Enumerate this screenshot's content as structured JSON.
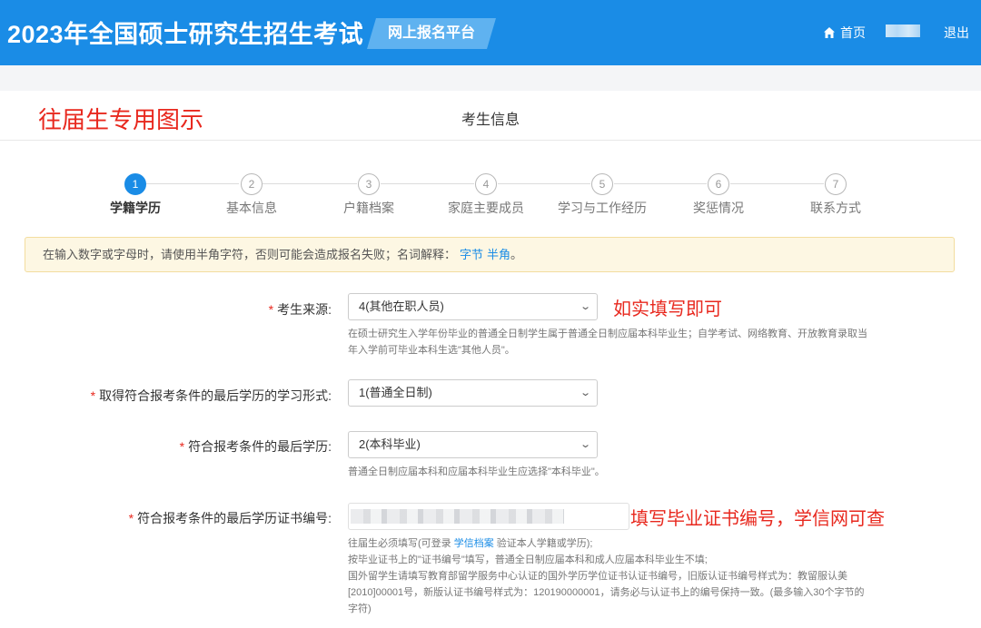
{
  "header": {
    "site_title": "2023年全国硕士研究生招生考试",
    "platform_label": "网上报名平台",
    "home_label": "首页",
    "logout_label": "退出",
    "home_icon": "home-icon"
  },
  "watermark": "往届生专用图示",
  "card_title": "考生信息",
  "steps": [
    {
      "num": "1",
      "label": "学籍学历",
      "active": true
    },
    {
      "num": "2",
      "label": "基本信息",
      "active": false
    },
    {
      "num": "3",
      "label": "户籍档案",
      "active": false
    },
    {
      "num": "4",
      "label": "家庭主要成员",
      "active": false
    },
    {
      "num": "5",
      "label": "学习与工作经历",
      "active": false
    },
    {
      "num": "6",
      "label": "奖惩情况",
      "active": false
    },
    {
      "num": "7",
      "label": "联系方式",
      "active": false
    }
  ],
  "notice": {
    "text": "在输入数字或字母时，请使用半角字符，否则可能会造成报名失败；名词解释：",
    "link1": "字节",
    "link2": "半角",
    "end": "。"
  },
  "form": {
    "source": {
      "label": "考生来源:",
      "value": "4(其他在职人员)",
      "help_line1": "在硕士研究生入学年份毕业的普通全日制学生属于普通全日制应届本科毕业生；自学考试、网络教育、开放教育录取当",
      "help_line2": "年入学前可毕业本科生选\"其他人员\"。",
      "annotation": "如实填写即可"
    },
    "study_form": {
      "label": "取得符合报考条件的最后学历的学习形式:",
      "value": "1(普通全日制)"
    },
    "last_degree": {
      "label": "符合报考条件的最后学历:",
      "value": "2(本科毕业)",
      "help": "普通全日制应届本科和应届本科毕业生应选择\"本科毕业\"。"
    },
    "cert_no": {
      "label": "符合报考条件的最后学历证书编号:",
      "annotation": "填写毕业证书编号，学信网可查",
      "help_a": "往届生必须填写(可登录 ",
      "help_link": "学信档案",
      "help_b": " 验证本人学籍或学历);",
      "help_line2": "按毕业证书上的\"证书编号\"填写，普通全日制应届本科和成人应届本科毕业生不填;",
      "help_line3": "国外留学生请填写教育部留学服务中心认证的国外学历学位证书认证书编号，旧版认证书编号样式为：教留服认美",
      "help_line4": "[2010]00001号，新版认证书编号样式为：120190000001，请务必与认证书上的编号保持一致。(最多输入30个字节的",
      "help_line5": "字符)"
    }
  },
  "colors": {
    "header_bg": "#1a8ce6",
    "badge_bg": "#5fb2f0",
    "annotation_red": "#e8281e",
    "notice_bg": "#fdf7e3",
    "link_blue": "#1a8ce6"
  }
}
